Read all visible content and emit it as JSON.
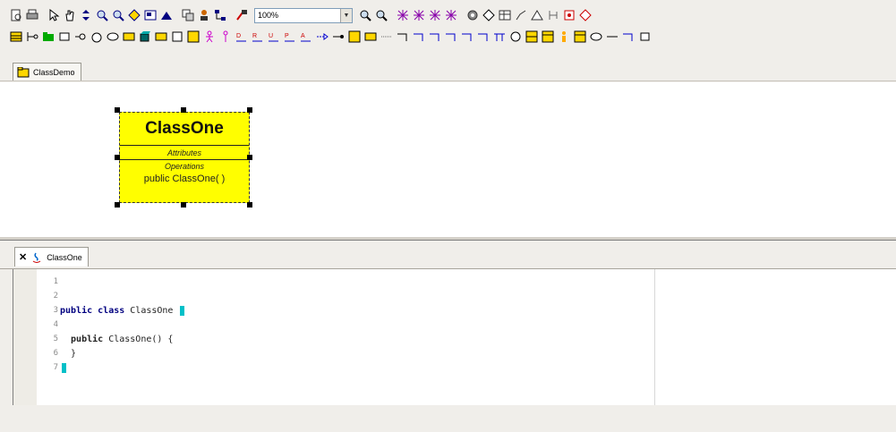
{
  "toolbar": {
    "zoom_value": "100%"
  },
  "diagram_tab": {
    "label": "ClassDemo"
  },
  "class_box": {
    "name": "ClassOne",
    "attributes_header": "Attributes",
    "operations_header": "Operations",
    "operations": [
      "public ClassOne( )"
    ],
    "fill_color": "#fffe00"
  },
  "code_tab": {
    "label": "ClassOne"
  },
  "editor": {
    "lines": [
      {
        "num": "1",
        "kw1": "",
        "kw2": "",
        "text": "",
        "cursor": false
      },
      {
        "num": "2",
        "kw1": "",
        "kw2": "",
        "text": "",
        "cursor": false
      },
      {
        "num": "3",
        "kw1": "public",
        "kw2": "class",
        "text": " ClassOne ",
        "cursor": true
      },
      {
        "num": "4",
        "kw1": "",
        "kw2": "",
        "text": "",
        "cursor": false
      },
      {
        "num": "5",
        "kw1": "  public",
        "kw2": "",
        "text": " ClassOne() {",
        "cursor": false
      },
      {
        "num": "6",
        "kw1": "",
        "kw2": "",
        "text": "  }",
        "cursor": false
      },
      {
        "num": "7",
        "kw1": "",
        "kw2": "",
        "text": "",
        "cursor": true
      }
    ],
    "cursor_color": "#00c0c8"
  }
}
